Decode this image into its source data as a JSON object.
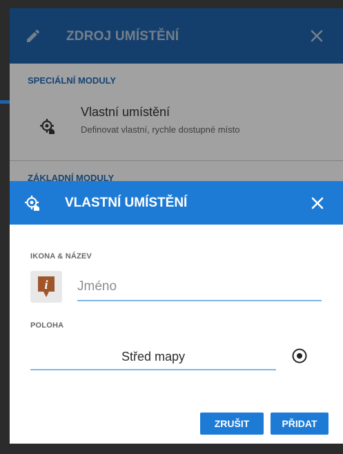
{
  "background_dialog": {
    "title": "ZDROJ UMÍSTĚNÍ",
    "section_special": "SPECIÁLNÍ MODULY",
    "item_title": "Vlastní umístění",
    "item_subtitle": "Definovat vlastní, rychle dostupné místo",
    "section_basic": "ZÁKLADNÍ MODULY"
  },
  "dialog": {
    "title": "VLASTNÍ UMÍSTĚNÍ",
    "icon_name_label": "IKONA & NÁZEV",
    "name_placeholder": "Jméno",
    "name_value": "",
    "position_label": "POLOHA",
    "position_value": "Střed mapy",
    "cancel_label": "ZRUŠIT",
    "add_label": "PŘIDAT"
  },
  "colors": {
    "header_dim": "#1d5b9c",
    "header": "#1e7bd5",
    "accent_line": "#7bb7e8",
    "poi_icon": "#a0562b"
  },
  "icons": [
    "pencil-icon",
    "close-icon",
    "custom-location-icon",
    "poi-info-icon",
    "target-icon"
  ]
}
